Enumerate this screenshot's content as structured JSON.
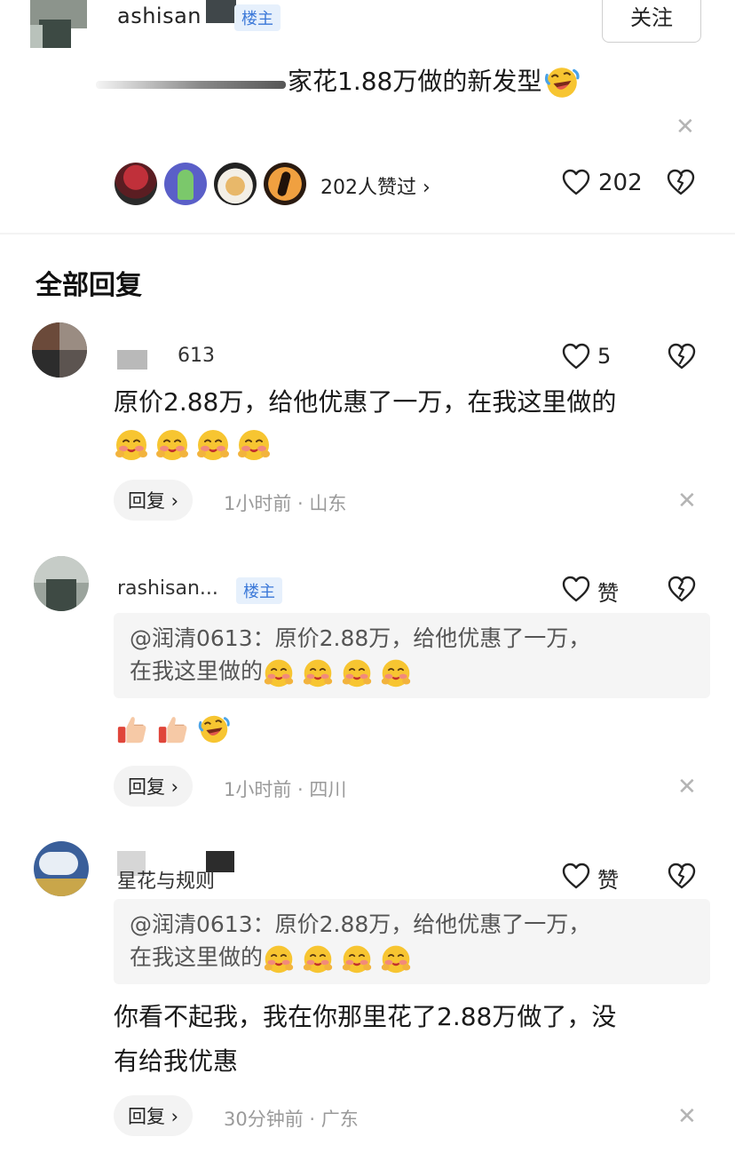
{
  "op": {
    "name_visible": "ashisan",
    "tag": "楼主",
    "follow_label": "关注",
    "text": "家花1.88万做的新发型",
    "likers_label": "202人赞过 ›",
    "like_count": "202"
  },
  "section_title": "全部回复",
  "comments": [
    {
      "name_visible": "613",
      "like_label": "5",
      "text": "原价2.88万，给他优惠了一万，在我这里做的",
      "reply_label": "回复 ›",
      "meta": "1小时前 · 山东"
    },
    {
      "name_visible": "rashisan...",
      "tag": "楼主",
      "like_label": "赞",
      "quote_line1": "@润清0613：原价2.88万，给他优惠了一万，",
      "quote_line2": "在我这里做的",
      "reply_label": "回复 ›",
      "meta": "1小时前 · 四川"
    },
    {
      "name_visible": "星花与规则",
      "like_label": "赞",
      "quote_line1": "@润清0613：原价2.88万，给他优惠了一万，",
      "quote_line2": "在我这里做的",
      "text_line1": "你看不起我，我在你那里花了2.88万做了，没",
      "text_line2": "有给我优惠",
      "reply_label": "回复 ›",
      "meta": "30分钟前 · 广东"
    }
  ],
  "icons": {
    "heart": "heart-outline-icon",
    "dislike": "broken-heart-icon",
    "close": "close-icon",
    "emoji_laugh": "laughing-tears-emoji",
    "emoji_shy": "shy-face-emoji",
    "emoji_thumb": "thumbs-up-emoji"
  },
  "colors": {
    "tag_bg": "#e6f0fc",
    "tag_text": "#3b78d8",
    "meta": "#9a9a9a",
    "quote_bg": "#f5f5f5"
  }
}
